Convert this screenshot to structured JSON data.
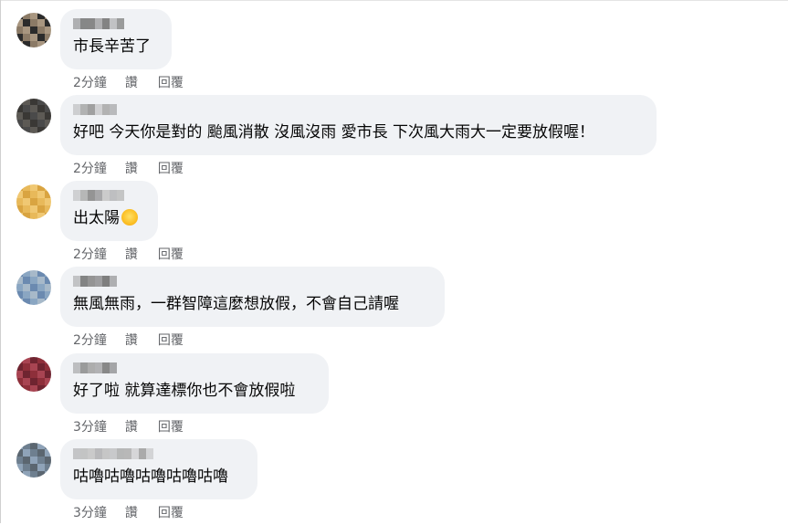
{
  "comments": [
    {
      "text": "市長辛苦了",
      "time": "2分鐘",
      "like_label": "讚",
      "reply_label": "回覆",
      "avatar_palette": [
        "#2b2b2b",
        "#5a4a3a",
        "#8b7a66",
        "#3d3226",
        "#a89680",
        "#1e1a16"
      ],
      "name_palette": [
        "#7a7a7a",
        "#9a9a9a",
        "#6a6a6a",
        "#8a8a8a",
        "#7c7c7c",
        "#5e5e5e"
      ]
    },
    {
      "text": "好吧 今天你是對的 颱風消散 沒風沒雨 愛市長 下次風大雨大一定要放假喔！",
      "time": "2分鐘",
      "like_label": "讚",
      "reply_label": "回覆",
      "avatar_palette": [
        "#4a4a4a",
        "#7a7268",
        "#5d5a55",
        "#8e8a84",
        "#3a3835",
        "#6b6660"
      ],
      "name_palette": [
        "#9a9a9a",
        "#b0b0b0",
        "#8c8c8c",
        "#a4a4a4",
        "#bdbdbd",
        "#989898"
      ]
    },
    {
      "text": "出太陽",
      "time": "2分鐘",
      "like_label": "讚",
      "reply_label": "回覆",
      "avatar_palette": [
        "#d9a441",
        "#c08a2c",
        "#e8b95a",
        "#b7792a",
        "#f0c873",
        "#a56a22"
      ],
      "name_palette": [
        "#8a8a8a",
        "#a0a0a0",
        "#b4b4b4",
        "#959595",
        "#c2c2c2",
        "#7e7e7e"
      ]
    },
    {
      "text": "無風無雨，一群智障這麼想放假，不會自己請喔",
      "time": "2分鐘",
      "like_label": "讚",
      "reply_label": "回覆",
      "avatar_palette": [
        "#6b8ab0",
        "#4f6f52",
        "#8aa6c2",
        "#3f5a3c",
        "#a7b9c9",
        "#5c7a5e"
      ],
      "name_palette": [
        "#6e6e6e",
        "#8a8a8a",
        "#5a5a5a",
        "#9c9c9c",
        "#787878",
        "#646464"
      ]
    },
    {
      "text": "好了啦 就算達標你也不會放假啦",
      "time": "3分鐘",
      "like_label": "讚",
      "reply_label": "回覆",
      "avatar_palette": [
        "#8e2f3a",
        "#c9c4be",
        "#a84452",
        "#e2ddd6",
        "#6f2430",
        "#b8b1a8"
      ],
      "name_palette": [
        "#707070",
        "#8e8e8e",
        "#a6a6a6",
        "#7a7a7a",
        "#949494",
        "#666666"
      ]
    },
    {
      "text": "咕嚕咕嚕咕嚕咕嚕咕嚕",
      "time": "3分鐘",
      "like_label": "讚",
      "reply_label": "回覆",
      "avatar_palette": [
        "#8fa3b8",
        "#c7ccd2",
        "#6e7f8f",
        "#b0b8c0",
        "#5b6670",
        "#d6dbe0"
      ],
      "name_palette": [
        "#a8a8a8",
        "#bcbcbc",
        "#9a9a9a",
        "#c6c6c6",
        "#b2b2b2",
        "#a0a0a0"
      ]
    }
  ]
}
